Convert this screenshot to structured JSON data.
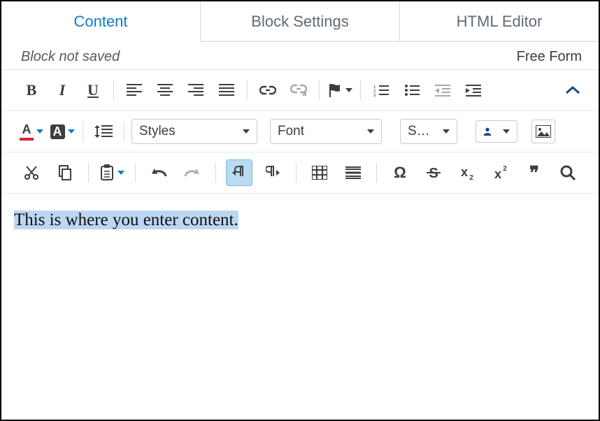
{
  "tabs": {
    "content": "Content",
    "block_settings": "Block Settings",
    "html_editor": "HTML Editor"
  },
  "status": {
    "not_saved": "Block not saved",
    "layout_type": "Free Form"
  },
  "dropdowns": {
    "styles": "Styles",
    "font": "Font",
    "size": "S…"
  },
  "editor": {
    "body": "This is where you enter content."
  },
  "glyph": {
    "A": "A",
    "omega": "Ω",
    "quotes": "❞"
  }
}
